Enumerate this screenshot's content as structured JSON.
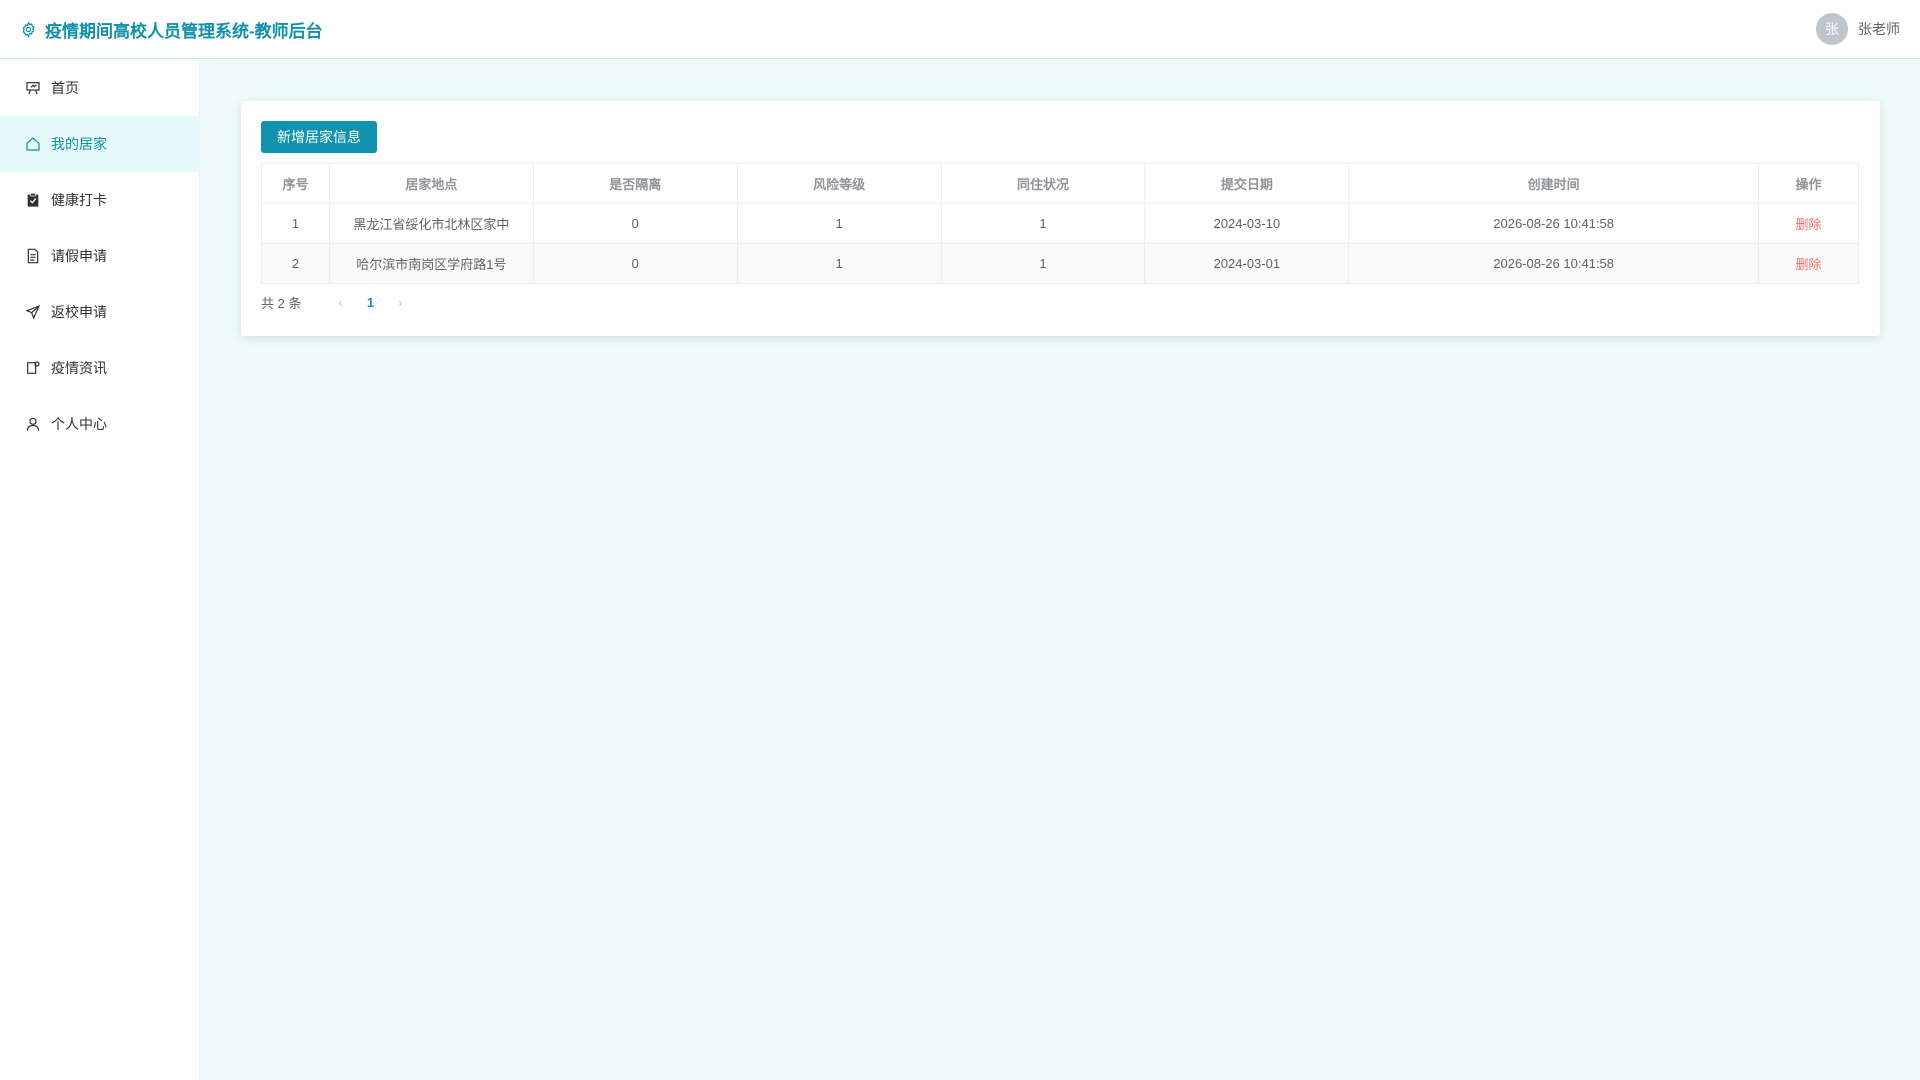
{
  "header": {
    "title": "疫情期间高校人员管理系统-教师后台",
    "avatar_text": "张",
    "user_name": "张老师"
  },
  "sidebar": {
    "items": [
      {
        "label": "首页",
        "icon": "presentation-icon"
      },
      {
        "label": "我的居家",
        "icon": "home-icon"
      },
      {
        "label": "健康打卡",
        "icon": "clipboard-icon"
      },
      {
        "label": "请假申请",
        "icon": "document-icon"
      },
      {
        "label": "返校申请",
        "icon": "send-icon"
      },
      {
        "label": "疫情资讯",
        "icon": "news-icon"
      },
      {
        "label": "个人中心",
        "icon": "user-icon"
      }
    ],
    "active_index": 1
  },
  "toolbar": {
    "add_label": "新增居家信息"
  },
  "table": {
    "columns": [
      "序号",
      "居家地点",
      "是否隔离",
      "风险等级",
      "同住状况",
      "提交日期",
      "创建时间",
      "操作"
    ],
    "rows": [
      [
        "1",
        "黑龙江省绥化市北林区家中",
        "0",
        "1",
        "1",
        "2024-03-10",
        "2026-08-26 10:41:58",
        "删除"
      ],
      [
        "2",
        "哈尔滨市南岗区学府路1号",
        "0",
        "1",
        "1",
        "2024-03-01",
        "2026-08-26 10:41:58",
        "删除"
      ]
    ]
  },
  "pagination": {
    "total_label": "共 2 条",
    "prev": "‹",
    "current_page": "1",
    "next": "›"
  },
  "colors": {
    "accent": "#1193b0",
    "danger": "#f56c6c",
    "main_bg": "#eefbfa"
  }
}
